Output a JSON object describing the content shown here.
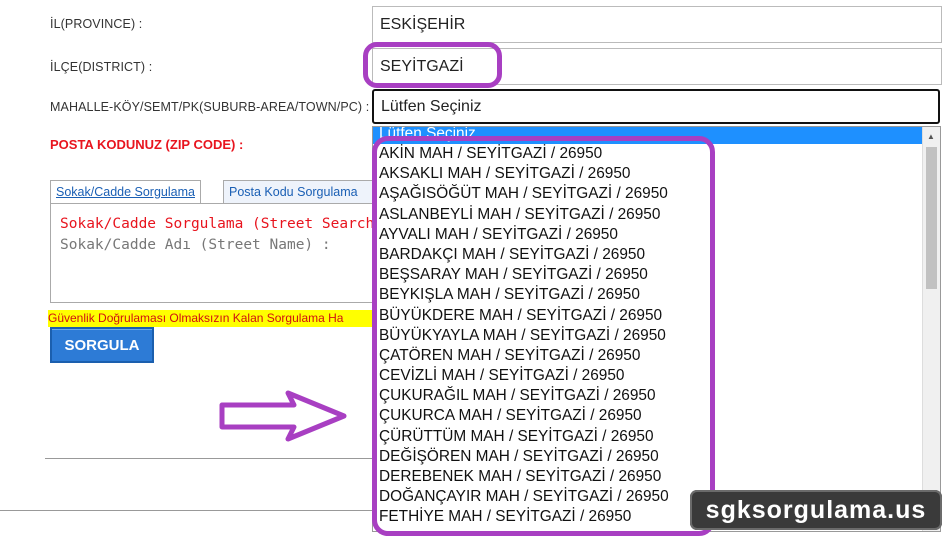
{
  "form": {
    "province_label": "İL(PROVINCE) :",
    "province_value": "ESKİŞEHİR",
    "district_label": "İLÇE(DISTRICT) :",
    "district_value": "SEYİTGAZİ",
    "suburb_label": "MAHALLE-KÖY/SEMT/PK(SUBURB-AREA/TOWN/PC) :",
    "suburb_value": "Lütfen Seçiniz",
    "zip_label": "POSTA KODUNUZ (ZIP CODE) :"
  },
  "tabs": [
    {
      "label": "Sokak/Cadde Sorgulama"
    },
    {
      "label": "Posta Kodu Sorgulama"
    }
  ],
  "street_search": {
    "title": "Sokak/Cadde Sorgulama (Street Search)",
    "name_label": "Sokak/Cadde Adı (Street Name) :"
  },
  "warning": "Güvenlik Doğrulaması Olmaksızın Kalan Sorgulama Ha",
  "query_button": "SORGULA",
  "dropdown": {
    "selected": "Lütfen Seçiniz",
    "options": [
      "AKİN MAH / SEYİTGAZİ / 26950",
      "AKSAKLI MAH / SEYİTGAZİ / 26950",
      "AŞAĞISÖĞÜT MAH / SEYİTGAZİ / 26950",
      "ASLANBEYLİ MAH / SEYİTGAZİ / 26950",
      "AYVALI MAH / SEYİTGAZİ / 26950",
      "BARDAKÇI MAH / SEYİTGAZİ / 26950",
      "BEŞSARAY MAH / SEYİTGAZİ / 26950",
      "BEYKIŞLA MAH / SEYİTGAZİ / 26950",
      "BÜYÜKDERE MAH / SEYİTGAZİ / 26950",
      "BÜYÜKYAYLA MAH / SEYİTGAZİ / 26950",
      "ÇATÖREN MAH / SEYİTGAZİ / 26950",
      "CEVİZLİ MAH / SEYİTGAZİ / 26950",
      "ÇUKURAĞIL MAH / SEYİTGAZİ / 26950",
      "ÇUKURCA MAH / SEYİTGAZİ / 26950",
      "ÇÜRÜTTÜM MAH / SEYİTGAZİ / 26950",
      "DEĞİŞÖREN MAH / SEYİTGAZİ / 26950",
      "DEREBENEK MAH / SEYİTGAZİ / 26950",
      "DOĞANÇAYIR MAH / SEYİTGAZİ / 26950",
      "FETHİYE MAH / SEYİTGAZİ / 26950"
    ]
  },
  "watermark": "sgksorgulama.us",
  "colors": {
    "highlight": "#a83fc2",
    "selected_option": "#1e90ff",
    "zip_label": "#e8141e",
    "button": "#2d7bd6",
    "warning_bg": "#ffff00"
  }
}
